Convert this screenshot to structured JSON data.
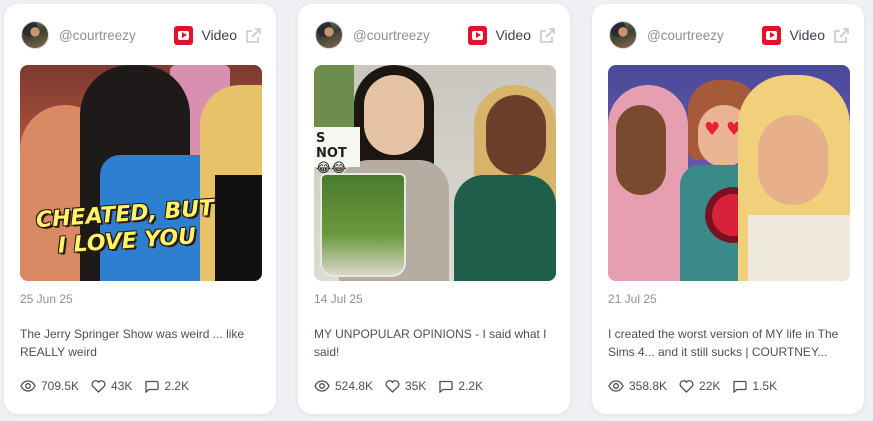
{
  "cards": [
    {
      "handle": "@courtreezy",
      "type_label": "Video",
      "platform_icon": "youtube-icon",
      "thumbnail_text": "CHEATED, BUT\nI LOVE YOU",
      "date": "25 Jun 25",
      "description": "The Jerry Springer Show was weird ... like REALLY weird",
      "views": "709.5K",
      "likes": "43K",
      "comments": "2.2K"
    },
    {
      "handle": "@courtreezy",
      "type_label": "Video",
      "platform_icon": "youtube-icon",
      "thumbnail_text": "S NOT\n😂😂",
      "date": "14 Jul 25",
      "description": "MY UNPOPULAR OPINIONS - I said what I said!",
      "views": "524.8K",
      "likes": "35K",
      "comments": "2.2K"
    },
    {
      "handle": "@courtreezy",
      "type_label": "Video",
      "platform_icon": "youtube-icon",
      "thumbnail_text": "",
      "date": "21 Jul 25",
      "description": "I created the worst version of MY life in The Sims 4... and it still sucks | COURTNEY...",
      "views": "358.8K",
      "likes": "22K",
      "comments": "1.5K"
    }
  ],
  "icons": {
    "views": "eye-icon",
    "likes": "heart-icon",
    "comments": "comment-icon",
    "external": "external-link-icon"
  },
  "colors": {
    "background": "#eef0f4",
    "card": "#ffffff",
    "youtube_red": "#e3122a",
    "muted_text": "#8b8f99",
    "body_text": "#4a4f5c"
  }
}
